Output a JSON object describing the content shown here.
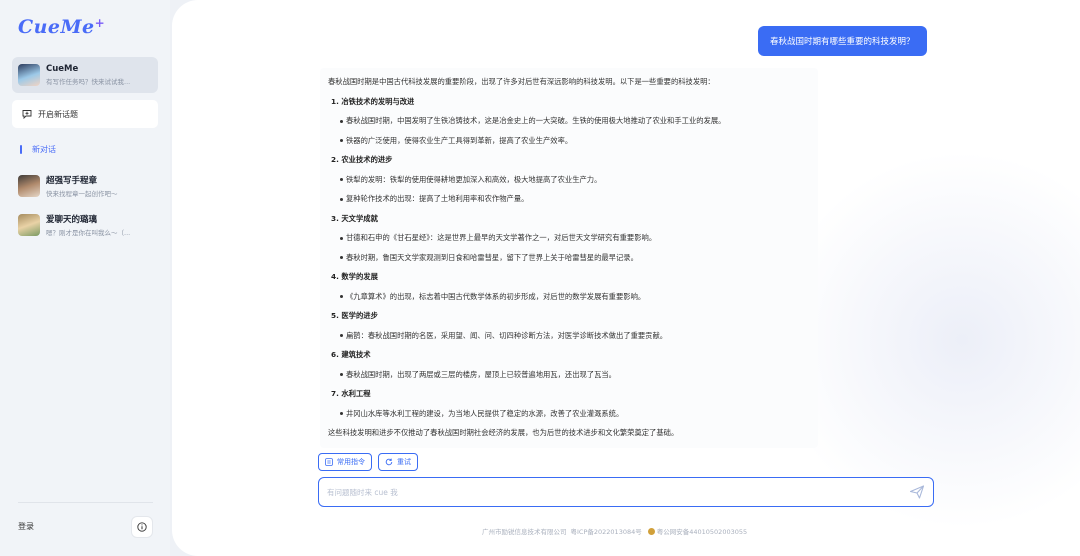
{
  "app": {
    "logo": "CueMe",
    "logo_plus": "+"
  },
  "sidebar": {
    "bot": {
      "name": "CueMe",
      "subtitle": "有写作任务吗？快来试试我..."
    },
    "new_topic": "开启新话题",
    "new_chat": "新对话",
    "chats": [
      {
        "title": "超强写手程章",
        "subtitle": "快来找程章一起创作吧～"
      },
      {
        "title": "爱聊天的璐璃",
        "subtitle": "嗯？刚才是你在叫我么～（..."
      }
    ],
    "login": "登录"
  },
  "conversation": {
    "user_message": "春秋战国时期有哪些重要的科技发明？",
    "answer": {
      "intro": "春秋战国时期是中国古代科技发展的重要阶段，出现了许多对后世有深远影响的科技发明。以下是一些重要的科技发明：",
      "sections": [
        {
          "title": "1. 冶铁技术的发明与改进",
          "bullets": [
            "春秋战国时期，中国发明了生铁冶铸技术，这是冶金史上的一大突破。生铁的使用极大地推动了农业和手工业的发展。",
            "铁器的广泛使用，使得农业生产工具得到革新，提高了农业生产效率。"
          ]
        },
        {
          "title": "2. 农业技术的进步",
          "bullets": [
            "铁犁的发明：铁犁的使用使得耕地更加深入和高效，极大地提高了农业生产力。",
            "复种轮作技术的出现：提高了土地利用率和农作物产量。"
          ]
        },
        {
          "title": "3. 天文学成就",
          "bullets": [
            "甘德和石申的《甘石星经》：这是世界上最早的天文学著作之一，对后世天文学研究有重要影响。",
            "春秋时期，鲁国天文学家观测到日食和哈雷彗星，留下了世界上关于哈雷彗星的最早记录。"
          ]
        },
        {
          "title": "4. 数学的发展",
          "bullets": [
            "《九章算术》的出现，标志着中国古代数学体系的初步形成，对后世的数学发展有重要影响。"
          ]
        },
        {
          "title": "5. 医学的进步",
          "bullets": [
            "扁鹊：春秋战国时期的名医，采用望、闻、问、切四种诊断方法，对医学诊断技术做出了重要贡献。"
          ]
        },
        {
          "title": "6. 建筑技术",
          "bullets": [
            "春秋战国时期，出现了两层或三层的楼房，屋顶上已较普遍地用瓦，还出现了瓦当。"
          ]
        },
        {
          "title": "7. 水利工程",
          "bullets": [
            "井冈山水库等水利工程的建设，为当地人民提供了稳定的水源，改善了农业灌溉系统。"
          ]
        }
      ],
      "outro": "这些科技发明和进步不仅推动了春秋战国时期社会经济的发展，也为后世的技术进步和文化繁荣奠定了基础。"
    },
    "actions": {
      "common_commands": "常用指令",
      "retry": "重试"
    }
  },
  "input": {
    "placeholder": "有问题随时来 cue 我"
  },
  "footer": {
    "company": "广州市励锐信息技术有限公司",
    "icp": "粤ICP备2022013084号",
    "police": "粤公网安备44010502003055"
  },
  "colors": {
    "accent": "#3a6cf4",
    "sidebar_bg": "#f1f4f8"
  },
  "icons": [
    "chat-plus-icon",
    "info-icon",
    "command-icon",
    "retry-icon",
    "send-icon"
  ]
}
